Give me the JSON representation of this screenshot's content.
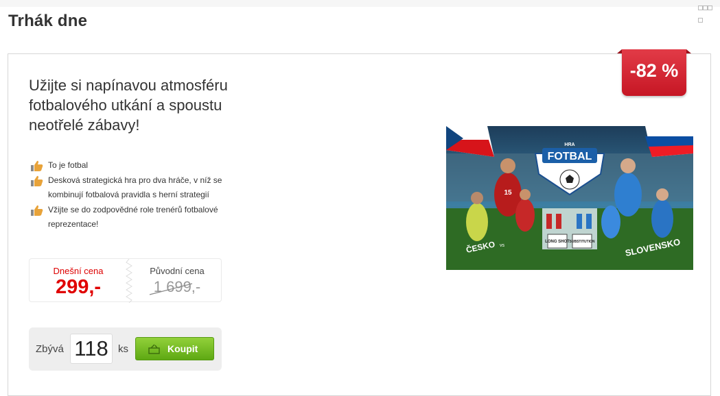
{
  "page": {
    "heading": "Trhák dne"
  },
  "deal": {
    "discount": "-82 %",
    "title": "Užijte si napínavou atmosféru fotbalového utkání a spoustu neotřelé zábavy!",
    "features": [
      "To je fotbal",
      "Desková strategická hra pro dva hráče, v níž se kombinují fotbalová pravidla s herní strategií",
      "Vžijte se do zodpovědné role trenérů fotbalové reprezentace!"
    ],
    "feature_icon": "thumbs-up-icon",
    "price": {
      "today_label": "Dnešní cena",
      "today_value": "299,-",
      "original_label": "Původní cena",
      "original_value": "1 699,-"
    },
    "stock": {
      "remaining_label": "Zbývá",
      "remaining_count": "118",
      "unit": "ks"
    },
    "buy_label": "Koupit",
    "buy_icon": "cart-icon"
  },
  "product_image": {
    "texts": {
      "brand": "HRA",
      "title": "FOTBAL",
      "left_team": "ČESKO",
      "vs": "vs",
      "right_team": "SLOVENSKO",
      "tag1": "LONG SHOT",
      "tag2": "SUBSTITUTION",
      "jersey_number_left": "15"
    }
  },
  "colors": {
    "accent_red": "#e00000",
    "ribbon": "#d42634",
    "buy_green": "#6fba1f"
  }
}
